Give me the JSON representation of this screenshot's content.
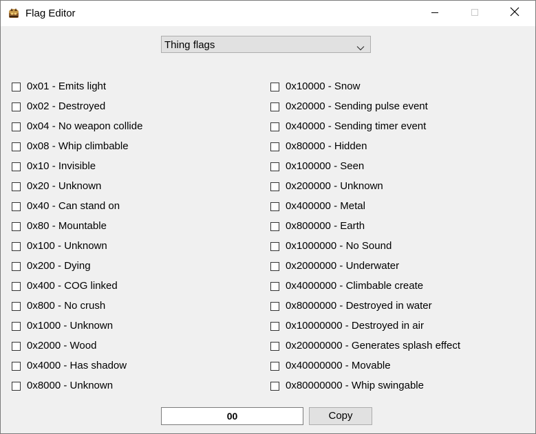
{
  "window": {
    "title": "Flag Editor"
  },
  "icons": {
    "app": "app-icon",
    "minimize": "minimize-icon",
    "maximize": "maximize-icon",
    "close": "close-icon",
    "dropdown": "chevron-down-icon"
  },
  "flag_type_select": {
    "selected": "Thing flags"
  },
  "flags_left": [
    {
      "label": "0x01 - Emits light",
      "checked": false
    },
    {
      "label": "0x02 - Destroyed",
      "checked": false
    },
    {
      "label": "0x04 - No weapon collide",
      "checked": false
    },
    {
      "label": "0x08 - Whip climbable",
      "checked": false
    },
    {
      "label": "0x10 - Invisible",
      "checked": false
    },
    {
      "label": "0x20 - Unknown",
      "checked": false
    },
    {
      "label": "0x40 - Can stand on",
      "checked": false
    },
    {
      "label": "0x80 - Mountable",
      "checked": false
    },
    {
      "label": "0x100 - Unknown",
      "checked": false
    },
    {
      "label": "0x200 - Dying",
      "checked": false
    },
    {
      "label": "0x400 - COG linked",
      "checked": false
    },
    {
      "label": "0x800 - No crush",
      "checked": false
    },
    {
      "label": "0x1000 - Unknown",
      "checked": false
    },
    {
      "label": "0x2000 - Wood",
      "checked": false
    },
    {
      "label": "0x4000 - Has shadow",
      "checked": false
    },
    {
      "label": "0x8000 - Unknown",
      "checked": false
    }
  ],
  "flags_right": [
    {
      "label": "0x10000 - Snow",
      "checked": false
    },
    {
      "label": "0x20000 - Sending pulse event",
      "checked": false
    },
    {
      "label": "0x40000 - Sending timer event",
      "checked": false
    },
    {
      "label": "0x80000 - Hidden",
      "checked": false
    },
    {
      "label": "0x100000 - Seen",
      "checked": false
    },
    {
      "label": "0x200000 - Unknown",
      "checked": false
    },
    {
      "label": "0x400000 - Metal",
      "checked": false
    },
    {
      "label": "0x800000 - Earth",
      "checked": false
    },
    {
      "label": "0x1000000 - No Sound",
      "checked": false
    },
    {
      "label": "0x2000000 - Underwater",
      "checked": false
    },
    {
      "label": "0x4000000 - Climbable create",
      "checked": false
    },
    {
      "label": "0x8000000 - Destroyed in water",
      "checked": false
    },
    {
      "label": "0x10000000 - Destroyed in air",
      "checked": false
    },
    {
      "label": "0x20000000 - Generates splash effect",
      "checked": false
    },
    {
      "label": "0x40000000 - Movable",
      "checked": false
    },
    {
      "label": "0x80000000 - Whip swingable",
      "checked": false
    }
  ],
  "footer": {
    "value": "00",
    "copy_label": "Copy"
  },
  "colors": {
    "window_bg": "#f0f0f0",
    "titlebar_bg": "#ffffff",
    "button_bg": "#e1e1e1",
    "button_border": "#adadad",
    "field_bg": "#ffffff"
  }
}
